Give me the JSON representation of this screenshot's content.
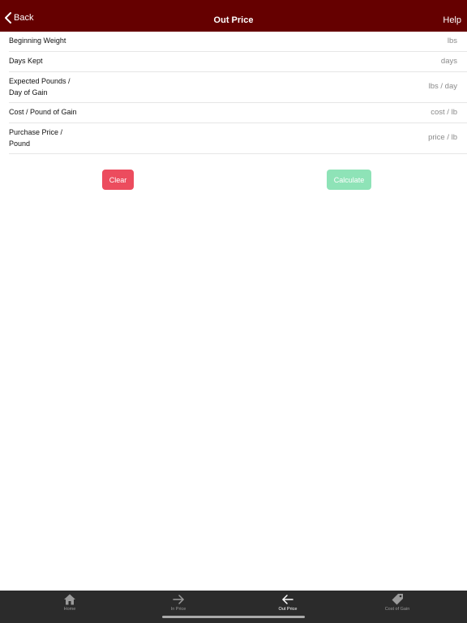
{
  "nav": {
    "back_label": "Back",
    "title": "Out Price",
    "help_label": "Help"
  },
  "form": {
    "fields": [
      {
        "label": "Beginning Weight",
        "placeholder": "lbs",
        "value": ""
      },
      {
        "label": "Days Kept",
        "placeholder": "days",
        "value": ""
      },
      {
        "label": "Expected Pounds /\nDay of Gain",
        "placeholder": "lbs / day",
        "value": ""
      },
      {
        "label": "Cost / Pound of Gain",
        "placeholder": "cost / lb",
        "value": ""
      },
      {
        "label": "Purchase Price /\nPound",
        "placeholder": "price / lb",
        "value": ""
      }
    ]
  },
  "buttons": {
    "clear_label": "Clear",
    "calculate_label": "Calculate"
  },
  "tabs": [
    {
      "label": "Home",
      "icon": "home-icon"
    },
    {
      "label": "In Price",
      "icon": "arrow-right-icon"
    },
    {
      "label": "Out Price",
      "icon": "arrow-left-icon"
    },
    {
      "label": "Cost of Gain",
      "icon": "tag-icon"
    }
  ],
  "active_tab": "Out Price",
  "colors": {
    "nav_background": "#650000",
    "clear_button": "#ec4c5e",
    "calculate_button": "#8ee3b7",
    "tabbar_background": "#2b2b2b"
  }
}
